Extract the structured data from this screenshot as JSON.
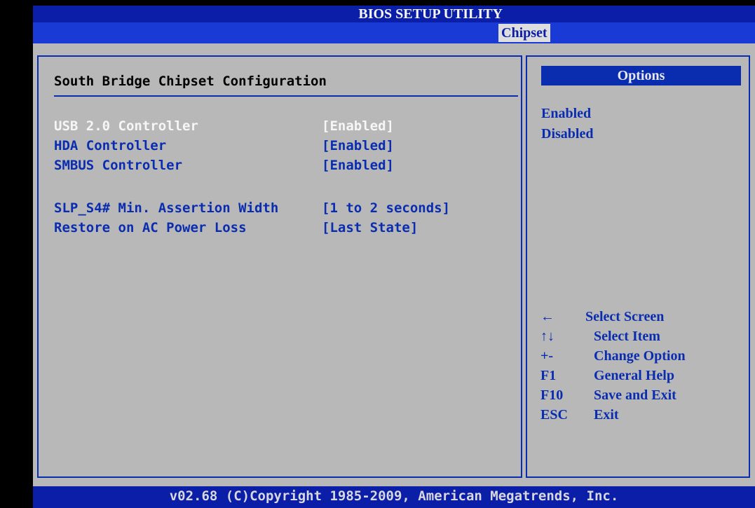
{
  "window": {
    "title": "BIOS SETUP UTILITY"
  },
  "tabs": [
    {
      "label": "Chipset",
      "active": true
    }
  ],
  "main": {
    "section_title": "South Bridge Chipset Configuration",
    "settings": [
      {
        "label": "USB 2.0 Controller",
        "value": "[Enabled]",
        "selected": true
      },
      {
        "label": "HDA Controller",
        "value": "[Enabled]",
        "selected": false
      },
      {
        "label": "SMBUS Controller",
        "value": "[Enabled]",
        "selected": false
      },
      {
        "label": "SLP_S4# Min. Assertion Width",
        "value": "[1 to 2 seconds]",
        "selected": false
      },
      {
        "label": "Restore on AC Power Loss",
        "value": "[Last State]",
        "selected": false
      }
    ]
  },
  "sidebar": {
    "options_header": "Options",
    "options": [
      "Enabled",
      "Disabled"
    ],
    "help": [
      {
        "key": "←",
        "desc": "Select Screen"
      },
      {
        "key": "↑↓",
        "desc": "Select Item"
      },
      {
        "key": "+-",
        "desc": "Change Option"
      },
      {
        "key": "F1",
        "desc": "General Help"
      },
      {
        "key": "F10",
        "desc": "Save and Exit"
      },
      {
        "key": "ESC",
        "desc": "Exit"
      }
    ]
  },
  "footer": {
    "text": "v02.68 (C)Copyright 1985-2009, American Megatrends, Inc."
  },
  "colors": {
    "bar_blue": "#0b1ea8",
    "tab_blue": "#1a3ad6",
    "panel_gray": "#b8b8b8",
    "text_blue": "#0a2db0",
    "highlight_white": "#f6f6f6"
  }
}
